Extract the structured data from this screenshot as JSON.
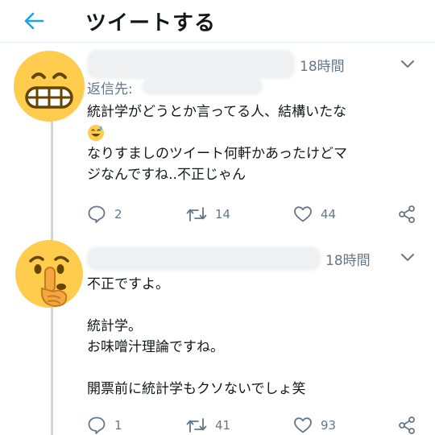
{
  "header": {
    "title": "ツイートする"
  },
  "tweets": [
    {
      "time": "18時間",
      "reply_prefix": "返信先:",
      "lines": [
        "統計学がどうとか言ってる人、結構いたな",
        "なりすましのツイート何軒かあったけどマ",
        "ジなんですね..不正じゃん"
      ],
      "actions": {
        "replies": "2",
        "retweets": "14",
        "likes": "44"
      },
      "avatar_icon": "grimacing-face-emoji",
      "inline_icon": "sweat-smile-emoji"
    },
    {
      "time": "18時間",
      "lines": [
        "不正ですよ。",
        "",
        "統計学。",
        "お味噌汁理論ですね。",
        "",
        "開票前に統計学もクソないでしょ笑"
      ],
      "actions": {
        "replies": "1",
        "retweets": "41",
        "likes": "93"
      },
      "avatar_icon": "shushing-face-emoji"
    }
  ],
  "colors": {
    "accent": "#1da1f2",
    "muted": "#657786",
    "text": "#14171a",
    "emoji": "#ffcc4d"
  }
}
